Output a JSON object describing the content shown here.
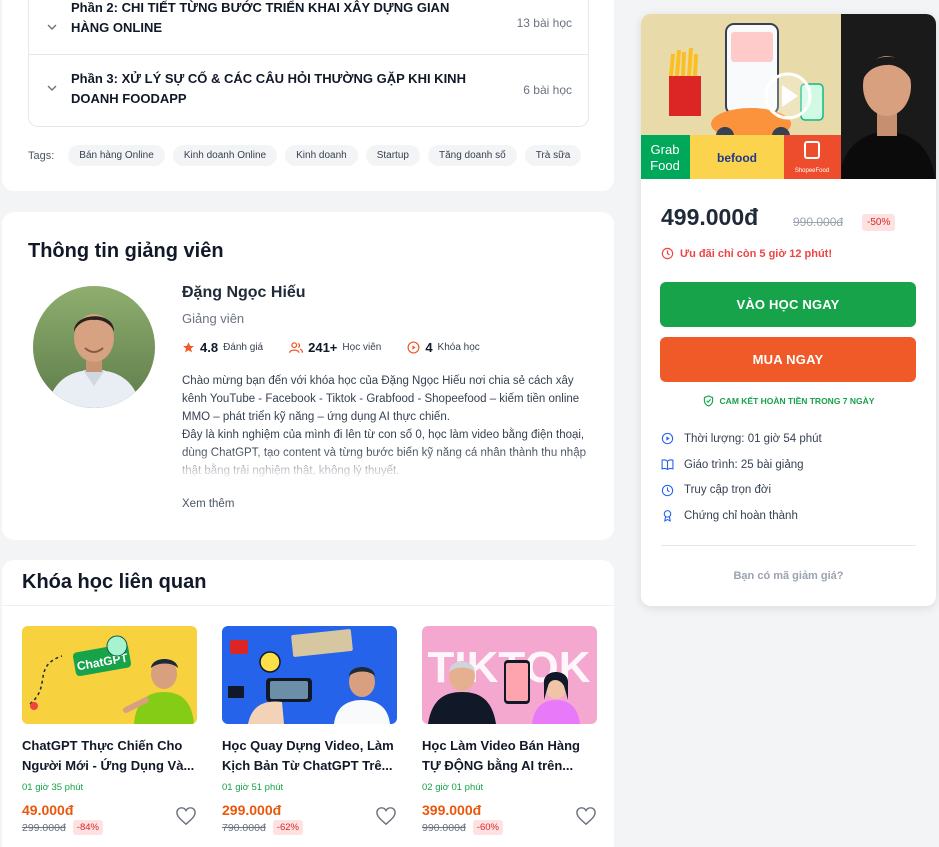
{
  "curriculum": {
    "sections": [
      {
        "title": "Phần 2: CHI TIẾT TỪNG BƯỚC TRIỂN KHAI XÂY DỰNG GIAN HÀNG ONLINE",
        "count": "13 bài học"
      },
      {
        "title": "Phần 3: XỬ LÝ SỰ CỐ & CÁC CÂU HỎI THƯỜNG GẶP KHI KINH DOANH FOODAPP",
        "count": "6 bài học"
      }
    ]
  },
  "tags": {
    "label": "Tags:",
    "items": [
      "Bán hàng Online",
      "Kinh doanh Online",
      "Kinh doanh",
      "Startup",
      "Tăng doanh số",
      "Trà sữa"
    ]
  },
  "instructor": {
    "heading": "Thông tin giảng viên",
    "name": "Đặng Ngọc Hiếu",
    "role": "Giảng viên",
    "rating": "4.8",
    "rating_label": "Đánh giá",
    "students": "241+",
    "students_label": "Học viên",
    "courses": "4",
    "courses_label": "Khóa học",
    "bio": "Chào mừng bạn đến với khóa học của Đặng Ngọc Hiếu nơi chia sẻ cách xây kênh YouTube - Facebook - Tiktok - Grabfood - Shopeefood – kiếm tiền online MMO – phát triển kỹ năng – ứng dụng AI thực chiến.",
    "bio2": "Đây là kinh nghiệm của mình đi lên từ con số 0, học làm video bằng điện thoại, dùng ChatGPT, tạo content và từng bước biến kỹ năng cá nhân thành thu nhập thật bằng trải nghiệm thật, không lý thuyết.",
    "see_more": "Xem thêm"
  },
  "related": {
    "heading": "Khóa học liên quan",
    "courses": [
      {
        "title": "ChatGPT Thực Chiến Cho Người Mới - Ứng Dụng Và...",
        "duration": "01 giờ 35 phút",
        "price": "49.000đ",
        "old_price": "299.000đ",
        "discount": "-84%",
        "thumb_text": "ChatGPT"
      },
      {
        "title": "Học Quay Dựng Video, Làm Kịch Bản Từ ChatGPT Trê...",
        "duration": "01 giờ 51 phút",
        "price": "299.000đ",
        "old_price": "790.000đ",
        "discount": "-62%",
        "thumb_text": ""
      },
      {
        "title": "Học Làm Video Bán Hàng TỰ ĐỘNG bằng AI trên...",
        "duration": "02 giờ 01 phút",
        "price": "399.000đ",
        "old_price": "990.000đ",
        "discount": "-60%",
        "thumb_text": "TIKTOK"
      }
    ]
  },
  "purchase": {
    "hero_logos": [
      "Grab Food",
      "befood",
      "ShopeeFood"
    ],
    "price": "499.000đ",
    "old_price": "990.000đ",
    "discount": "-50%",
    "offer": "Ưu đãi chỉ còn 5 giờ 12 phút!",
    "enroll_button": "VÀO HỌC NGAY",
    "buy_button": "MUA NGAY",
    "guarantee": "CAM KẾT HOÀN TIỀN TRONG 7 NGÀY",
    "features": [
      {
        "icon": "play-circle-icon",
        "text": "Thời lượng: 01 giờ 54 phút"
      },
      {
        "icon": "book-open-icon",
        "text": "Giáo trình: 25 bài giảng"
      },
      {
        "icon": "clock-icon",
        "text": "Truy cập trọn đời"
      },
      {
        "icon": "award-icon",
        "text": "Chứng chỉ hoàn thành"
      }
    ],
    "coupon": "Bạn có mã giảm giá?"
  },
  "colors": {
    "accent_green": "#16a34a",
    "accent_orange": "#f05a28",
    "price_orange": "#ea580c",
    "danger": "#ef4444"
  }
}
